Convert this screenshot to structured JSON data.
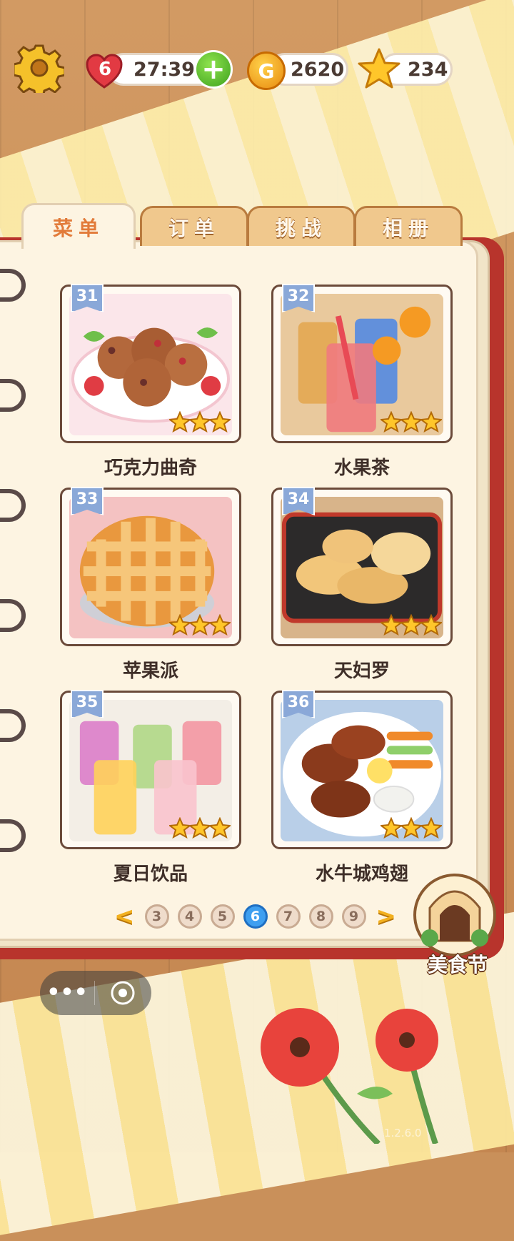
{
  "status": {
    "lives": "6",
    "timer": "27:39",
    "coins": "2620",
    "coin_symbol": "G",
    "stars": "234",
    "add_label": "+"
  },
  "tabs": [
    {
      "label": "菜单",
      "active": true
    },
    {
      "label": "订单",
      "active": false
    },
    {
      "label": "挑战",
      "active": false
    },
    {
      "label": "相册",
      "active": false
    }
  ],
  "recipes": [
    {
      "number": "31",
      "name": "巧克力曲奇",
      "stars": 3
    },
    {
      "number": "32",
      "name": "水果茶",
      "stars": 3
    },
    {
      "number": "33",
      "name": "苹果派",
      "stars": 3
    },
    {
      "number": "34",
      "name": "天妇罗",
      "stars": 3
    },
    {
      "number": "35",
      "name": "夏日饮品",
      "stars": 3
    },
    {
      "number": "36",
      "name": "水牛城鸡翅",
      "stars": 3
    }
  ],
  "pager": {
    "prev": "<",
    "next": ">",
    "pages": [
      "3",
      "4",
      "5",
      "6",
      "7",
      "8",
      "9"
    ],
    "current": "6"
  },
  "festival": {
    "label": "美食节"
  },
  "capsule": {
    "more": "•••"
  },
  "version": "1.2.6.0"
}
